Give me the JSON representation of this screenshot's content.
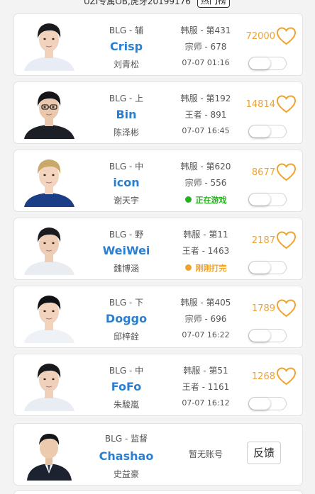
{
  "header": {
    "ticker_text": "UZI专属OB,虎牙20199176",
    "hot_list_label": "热门榜"
  },
  "colors": {
    "name_blue": "#2a7fd1",
    "like_orange": "#f0a22f",
    "online_green": "#22b21b",
    "just_played_orange": "#f0a22f"
  },
  "players": [
    {
      "team": "BLG - 辅",
      "name": "Crisp",
      "real_name": "刘青松",
      "server": "韩服 - 第431",
      "rank": "宗师 - 678",
      "status": "07-07 01:16",
      "status_type": "time",
      "likes": "72000",
      "avatar": "player-photo",
      "toggle_on": false
    },
    {
      "team": "BLG - 上",
      "name": "Bin",
      "real_name": "陈泽彬",
      "server": "韩服 - 第192",
      "rank": "王者 - 891",
      "status": "07-07 16:45",
      "status_type": "time",
      "likes": "14814",
      "avatar": "player-photo",
      "toggle_on": false
    },
    {
      "team": "BLG - 中",
      "name": "icon",
      "real_name": "谢天宇",
      "server": "韩服 - 第620",
      "rank": "宗师 - 556",
      "status": "正在游戏",
      "status_type": "online",
      "likes": "8677",
      "avatar": "player-photo",
      "toggle_on": false
    },
    {
      "team": "BLG - 野",
      "name": "WeiWei",
      "real_name": "魏博涵",
      "server": "韩服 - 第11",
      "rank": "王者 - 1463",
      "status": "刚刚打完",
      "status_type": "just_played",
      "likes": "2187",
      "avatar": "player-photo",
      "toggle_on": false
    },
    {
      "team": "BLG - 下",
      "name": "Doggo",
      "real_name": "邱梓銓",
      "server": "韩服 - 第405",
      "rank": "宗师 - 696",
      "status": "07-07 16:22",
      "status_type": "time",
      "likes": "1789",
      "avatar": "player-photo",
      "toggle_on": false
    },
    {
      "team": "BLG - 中",
      "name": "FoFo",
      "real_name": "朱駿嵐",
      "server": "韩服 - 第51",
      "rank": "王者 - 1161",
      "status": "07-07 16:12",
      "status_type": "time",
      "likes": "1268",
      "avatar": "player-photo",
      "toggle_on": false
    }
  ],
  "staff": {
    "team": "BLG - 监督",
    "name": "Chashao",
    "real_name": "史益豪",
    "no_account": "暂无账号",
    "feedback_label": "反馈"
  }
}
